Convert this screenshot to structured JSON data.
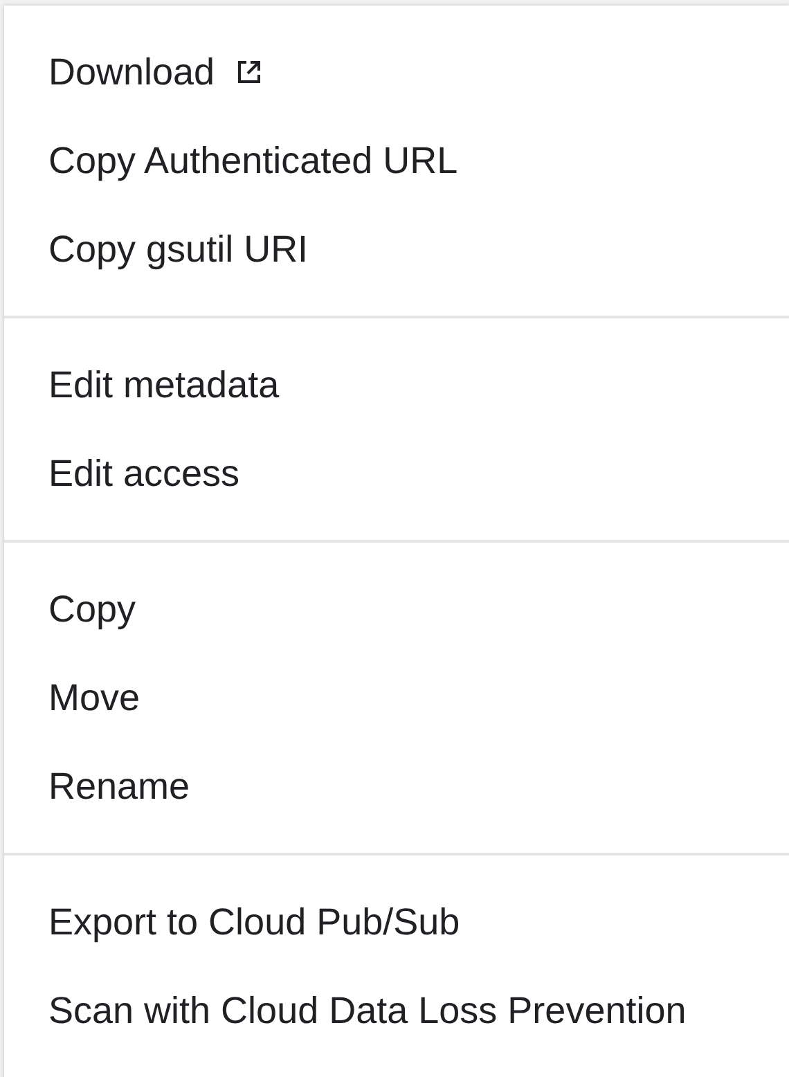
{
  "menu": {
    "groups": [
      {
        "items": [
          {
            "label": "Download",
            "external": true
          },
          {
            "label": "Copy Authenticated URL",
            "external": false
          },
          {
            "label": "Copy gsutil URI",
            "external": false
          }
        ]
      },
      {
        "items": [
          {
            "label": "Edit metadata",
            "external": false
          },
          {
            "label": "Edit access",
            "external": false
          }
        ]
      },
      {
        "items": [
          {
            "label": "Copy",
            "external": false
          },
          {
            "label": "Move",
            "external": false
          },
          {
            "label": "Rename",
            "external": false
          }
        ]
      },
      {
        "items": [
          {
            "label": "Export to Cloud Pub/Sub",
            "external": false
          },
          {
            "label": "Scan with Cloud Data Loss Prevention",
            "external": false
          }
        ]
      }
    ]
  }
}
